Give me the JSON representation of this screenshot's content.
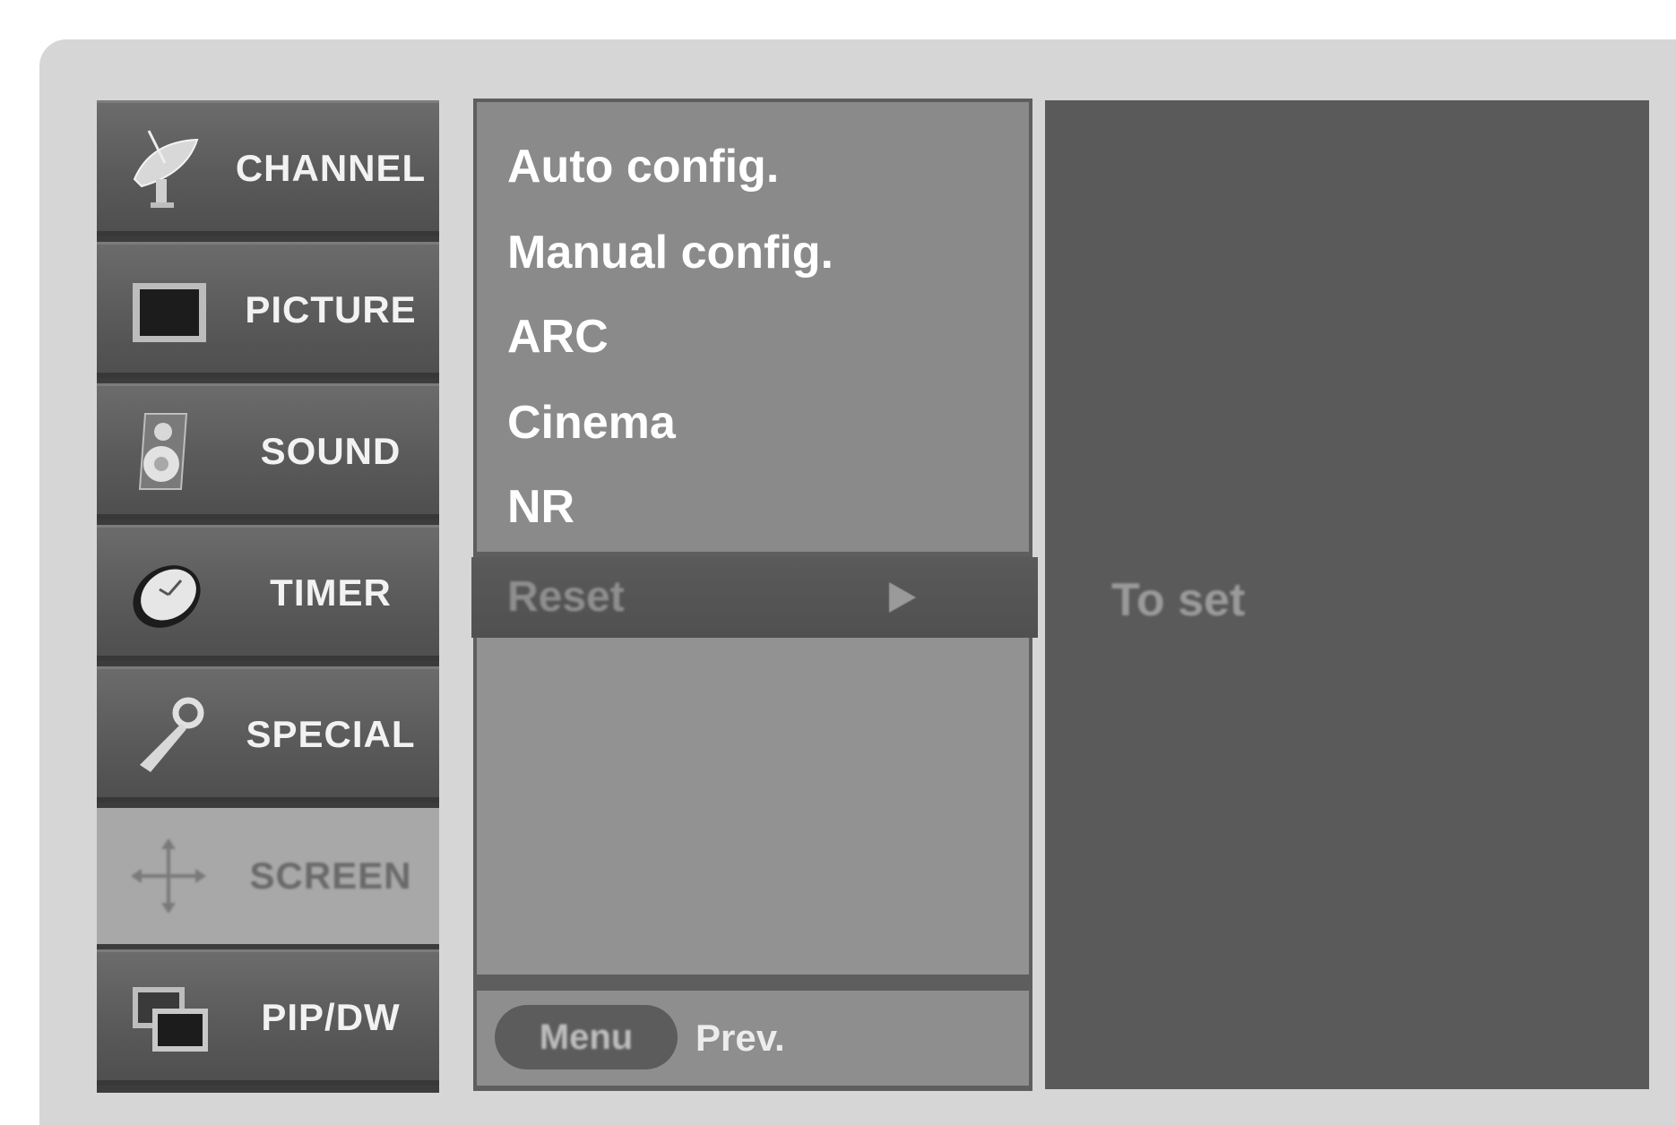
{
  "sidebar": {
    "items": [
      {
        "label": "CHANNEL",
        "icon": "satellite-dish-icon",
        "active": false
      },
      {
        "label": "PICTURE",
        "icon": "tv-screen-icon",
        "active": false
      },
      {
        "label": "SOUND",
        "icon": "speaker-icon",
        "active": false
      },
      {
        "label": "TIMER",
        "icon": "clock-icon",
        "active": false
      },
      {
        "label": "SPECIAL",
        "icon": "key-icon",
        "active": false
      },
      {
        "label": "SCREEN",
        "icon": "move-arrows-icon",
        "active": true
      },
      {
        "label": "PIP/DW",
        "icon": "pip-windows-icon",
        "active": false
      }
    ]
  },
  "menu": {
    "items": [
      "Auto config.",
      "Manual config.",
      "ARC",
      "Cinema",
      "NR"
    ],
    "selected": {
      "label": "Reset",
      "arrow": "right-arrow-icon"
    }
  },
  "footer": {
    "button_label": "Menu",
    "action_label": "Prev."
  },
  "right_panel": {
    "hint": "To set"
  },
  "colors": {
    "background": "#d6d6d6",
    "sidebar_item": "#5a5a5a",
    "sidebar_active": "#a8a8a8",
    "menu_bg": "#8a8a8a",
    "selected_bar": "#555555",
    "right_panel": "#5a5a5a",
    "text": "#ffffff"
  }
}
